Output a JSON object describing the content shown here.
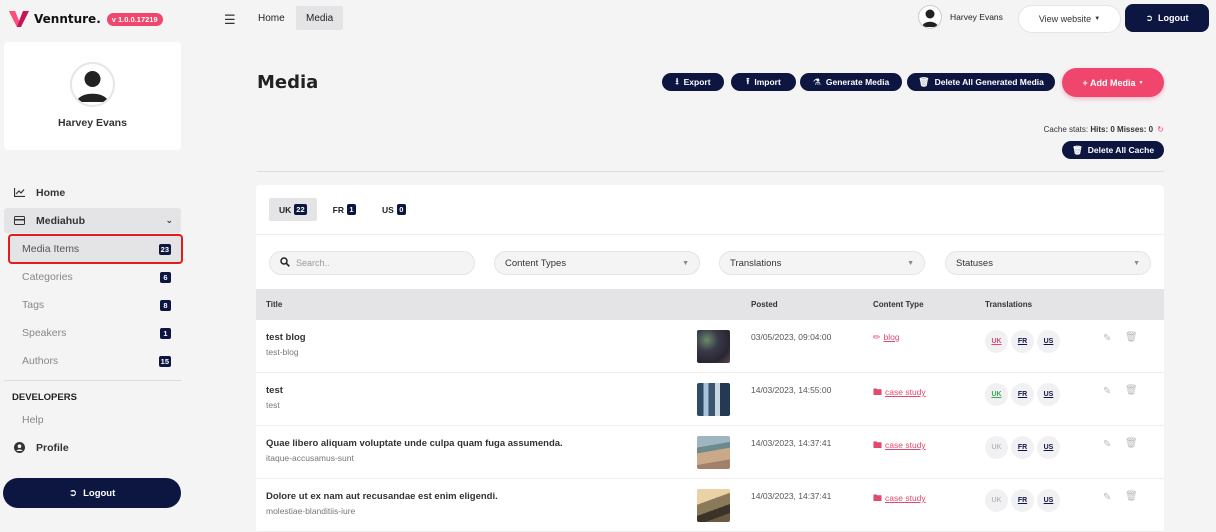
{
  "brand": {
    "name": "Vennture.",
    "version": "v 1.0.0.17219"
  },
  "profile": {
    "name": "Harvey Evans"
  },
  "nav": {
    "home": "Home",
    "mediahub": "Mediahub",
    "sub_items": [
      {
        "label": "Media Items",
        "count": "23"
      },
      {
        "label": "Categories",
        "count": "6"
      },
      {
        "label": "Tags",
        "count": "8"
      },
      {
        "label": "Speakers",
        "count": "1"
      },
      {
        "label": "Authors",
        "count": "15"
      }
    ],
    "developers": "DEVELOPERS",
    "help": "Help",
    "profile": "Profile",
    "logout": "Logout"
  },
  "topbar": {
    "breadcrumbs": [
      "Home",
      "Media"
    ],
    "user_name": "Harvey Evans",
    "view_website": "View website",
    "logout": "Logout"
  },
  "page": {
    "title": "Media"
  },
  "actions": {
    "export": "Export",
    "import": "Import",
    "generate": "Generate Media",
    "delete_generated": "Delete All Generated Media",
    "add_media": "+ Add Media"
  },
  "cache": {
    "label": "Cache stats:",
    "hits": "Hits: 0",
    "misses": "Misses: 0",
    "delete": "Delete All Cache"
  },
  "tabs": [
    {
      "label": "UK",
      "count": "22"
    },
    {
      "label": "FR",
      "count": "1"
    },
    {
      "label": "US",
      "count": "0"
    }
  ],
  "filters": {
    "search_placeholder": "Search..",
    "content_types": "Content Types",
    "translations": "Translations",
    "statuses": "Statuses"
  },
  "table": {
    "columns": [
      "Title",
      "Posted",
      "Content Type",
      "Translations"
    ],
    "rows": [
      {
        "title": "test blog",
        "slug": "test-blog",
        "posted": "03/05/2023, 09:04:00",
        "content_type": "blog",
        "translations": [
          "UK",
          "FR",
          "US"
        ]
      },
      {
        "title": "test",
        "slug": "test",
        "posted": "14/03/2023, 14:55:00",
        "content_type": "case study",
        "translations": [
          "UK",
          "FR",
          "US"
        ]
      },
      {
        "title": "Quae libero aliquam voluptate unde culpa quam fuga assumenda.",
        "slug": "itaque-accusamus-sunt",
        "posted": "14/03/2023, 14:37:41",
        "content_type": "case study",
        "translations": [
          "UK",
          "FR",
          "US"
        ]
      },
      {
        "title": "Dolore ut ex nam aut recusandae est enim eligendi.",
        "slug": "molestiae-blanditiis-iure",
        "posted": "14/03/2023, 14:37:41",
        "content_type": "case study",
        "translations": [
          "UK",
          "FR",
          "US"
        ]
      }
    ]
  },
  "colors": {
    "navy": "#0d1541",
    "pink": "#f0456c",
    "highlight": "#e01c1c"
  }
}
